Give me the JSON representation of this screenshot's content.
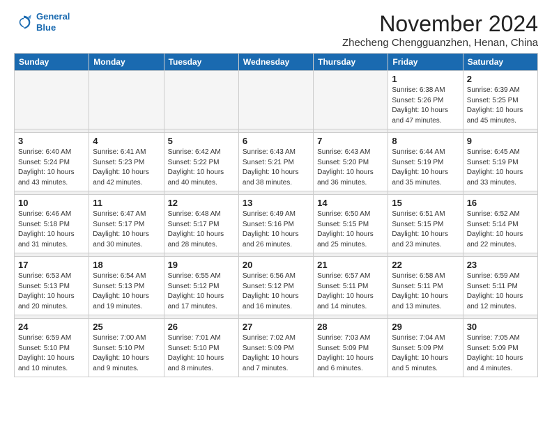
{
  "logo": {
    "line1": "General",
    "line2": "Blue"
  },
  "title": "November 2024",
  "location": "Zhecheng Chengguanzhen, Henan, China",
  "days_of_week": [
    "Sunday",
    "Monday",
    "Tuesday",
    "Wednesday",
    "Thursday",
    "Friday",
    "Saturday"
  ],
  "weeks": [
    [
      {
        "day": "",
        "info": ""
      },
      {
        "day": "",
        "info": ""
      },
      {
        "day": "",
        "info": ""
      },
      {
        "day": "",
        "info": ""
      },
      {
        "day": "",
        "info": ""
      },
      {
        "day": "1",
        "info": "Sunrise: 6:38 AM\nSunset: 5:26 PM\nDaylight: 10 hours and 47 minutes."
      },
      {
        "day": "2",
        "info": "Sunrise: 6:39 AM\nSunset: 5:25 PM\nDaylight: 10 hours and 45 minutes."
      }
    ],
    [
      {
        "day": "3",
        "info": "Sunrise: 6:40 AM\nSunset: 5:24 PM\nDaylight: 10 hours and 43 minutes."
      },
      {
        "day": "4",
        "info": "Sunrise: 6:41 AM\nSunset: 5:23 PM\nDaylight: 10 hours and 42 minutes."
      },
      {
        "day": "5",
        "info": "Sunrise: 6:42 AM\nSunset: 5:22 PM\nDaylight: 10 hours and 40 minutes."
      },
      {
        "day": "6",
        "info": "Sunrise: 6:43 AM\nSunset: 5:21 PM\nDaylight: 10 hours and 38 minutes."
      },
      {
        "day": "7",
        "info": "Sunrise: 6:43 AM\nSunset: 5:20 PM\nDaylight: 10 hours and 36 minutes."
      },
      {
        "day": "8",
        "info": "Sunrise: 6:44 AM\nSunset: 5:19 PM\nDaylight: 10 hours and 35 minutes."
      },
      {
        "day": "9",
        "info": "Sunrise: 6:45 AM\nSunset: 5:19 PM\nDaylight: 10 hours and 33 minutes."
      }
    ],
    [
      {
        "day": "10",
        "info": "Sunrise: 6:46 AM\nSunset: 5:18 PM\nDaylight: 10 hours and 31 minutes."
      },
      {
        "day": "11",
        "info": "Sunrise: 6:47 AM\nSunset: 5:17 PM\nDaylight: 10 hours and 30 minutes."
      },
      {
        "day": "12",
        "info": "Sunrise: 6:48 AM\nSunset: 5:17 PM\nDaylight: 10 hours and 28 minutes."
      },
      {
        "day": "13",
        "info": "Sunrise: 6:49 AM\nSunset: 5:16 PM\nDaylight: 10 hours and 26 minutes."
      },
      {
        "day": "14",
        "info": "Sunrise: 6:50 AM\nSunset: 5:15 PM\nDaylight: 10 hours and 25 minutes."
      },
      {
        "day": "15",
        "info": "Sunrise: 6:51 AM\nSunset: 5:15 PM\nDaylight: 10 hours and 23 minutes."
      },
      {
        "day": "16",
        "info": "Sunrise: 6:52 AM\nSunset: 5:14 PM\nDaylight: 10 hours and 22 minutes."
      }
    ],
    [
      {
        "day": "17",
        "info": "Sunrise: 6:53 AM\nSunset: 5:13 PM\nDaylight: 10 hours and 20 minutes."
      },
      {
        "day": "18",
        "info": "Sunrise: 6:54 AM\nSunset: 5:13 PM\nDaylight: 10 hours and 19 minutes."
      },
      {
        "day": "19",
        "info": "Sunrise: 6:55 AM\nSunset: 5:12 PM\nDaylight: 10 hours and 17 minutes."
      },
      {
        "day": "20",
        "info": "Sunrise: 6:56 AM\nSunset: 5:12 PM\nDaylight: 10 hours and 16 minutes."
      },
      {
        "day": "21",
        "info": "Sunrise: 6:57 AM\nSunset: 5:11 PM\nDaylight: 10 hours and 14 minutes."
      },
      {
        "day": "22",
        "info": "Sunrise: 6:58 AM\nSunset: 5:11 PM\nDaylight: 10 hours and 13 minutes."
      },
      {
        "day": "23",
        "info": "Sunrise: 6:59 AM\nSunset: 5:11 PM\nDaylight: 10 hours and 12 minutes."
      }
    ],
    [
      {
        "day": "24",
        "info": "Sunrise: 6:59 AM\nSunset: 5:10 PM\nDaylight: 10 hours and 10 minutes."
      },
      {
        "day": "25",
        "info": "Sunrise: 7:00 AM\nSunset: 5:10 PM\nDaylight: 10 hours and 9 minutes."
      },
      {
        "day": "26",
        "info": "Sunrise: 7:01 AM\nSunset: 5:10 PM\nDaylight: 10 hours and 8 minutes."
      },
      {
        "day": "27",
        "info": "Sunrise: 7:02 AM\nSunset: 5:09 PM\nDaylight: 10 hours and 7 minutes."
      },
      {
        "day": "28",
        "info": "Sunrise: 7:03 AM\nSunset: 5:09 PM\nDaylight: 10 hours and 6 minutes."
      },
      {
        "day": "29",
        "info": "Sunrise: 7:04 AM\nSunset: 5:09 PM\nDaylight: 10 hours and 5 minutes."
      },
      {
        "day": "30",
        "info": "Sunrise: 7:05 AM\nSunset: 5:09 PM\nDaylight: 10 hours and 4 minutes."
      }
    ]
  ]
}
